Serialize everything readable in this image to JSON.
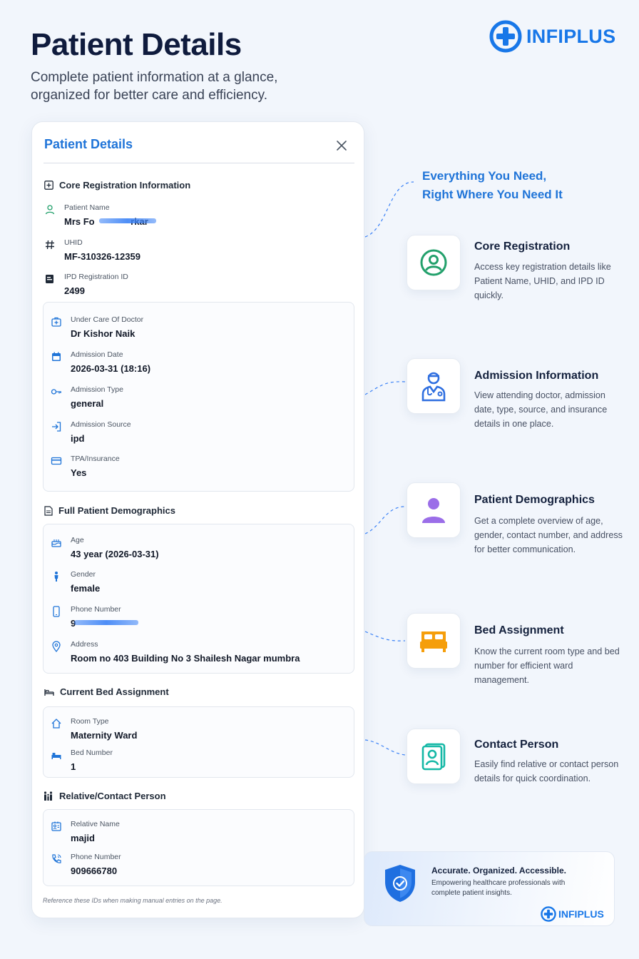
{
  "hero": {
    "title": "Patient Details",
    "subtitle": "Complete patient information at a glance, organized for better care and efficiency."
  },
  "brand": {
    "name": "INFIPLUS",
    "color": "#1877e8"
  },
  "card": {
    "title": "Patient Details",
    "close_icon": "close-icon",
    "core": {
      "heading": "Core Registration Information",
      "patient_name": {
        "label": "Patient Name",
        "value": "Mrs Fo              rkar"
      },
      "uhid": {
        "label": "UHID",
        "value": "MF-310326-12359"
      },
      "ipd": {
        "label": "IPD Registration ID",
        "value": "2499"
      },
      "doctor": {
        "label": "Under Care Of Doctor",
        "value": "Dr Kishor Naik"
      },
      "admission_date": {
        "label": "Admission Date",
        "value": "2026-03-31 (18:16)"
      },
      "admission_type": {
        "label": "Admission Type",
        "value": "general"
      },
      "admission_source": {
        "label": "Admission Source",
        "value": "ipd"
      },
      "tpa": {
        "label": "TPA/Insurance",
        "value": "Yes"
      }
    },
    "demographics": {
      "heading": "Full Patient Demographics",
      "age": {
        "label": "Age",
        "value": "43 year (2026-03-31)"
      },
      "gender": {
        "label": "Gender",
        "value": "female"
      },
      "phone": {
        "label": "Phone Number",
        "value": "9"
      },
      "address": {
        "label": "Address",
        "value": "Room no 403 Building No 3 Shailesh Nagar mumbra"
      }
    },
    "bed": {
      "heading": "Current Bed Assignment",
      "room_type": {
        "label": "Room Type",
        "value": "Maternity Ward"
      },
      "bed_number": {
        "label": "Bed Number",
        "value": "1"
      }
    },
    "contact": {
      "heading": "Relative/Contact Person",
      "relative_name": {
        "label": "Relative Name",
        "value": "majid"
      },
      "phone": {
        "label": "Phone Number",
        "value": "909666780"
      }
    },
    "footnote": "Reference these IDs when making manual entries on the page."
  },
  "tagline": {
    "line1": "Everything You Need,",
    "line2": "Right Where You Need It"
  },
  "features": [
    {
      "title": "Core Registration",
      "desc": "Access key registration details like Patient Name, UHID, and IPD ID quickly.",
      "icon": "user-circle-icon",
      "color": "#22a06b"
    },
    {
      "title": "Admission Information",
      "desc": "View attending doctor, admission date, type, source, and insurance details in one place.",
      "icon": "doctor-icon",
      "color": "#2f6fe0"
    },
    {
      "title": "Patient Demographics",
      "desc": "Get a complete overview of age, gender, contact number, and address for better communication.",
      "icon": "person-icon",
      "color": "#9b6ee8"
    },
    {
      "title": "Bed Assignment",
      "desc": "Know the current room type and bed number for efficient ward management.",
      "icon": "bed-icon",
      "color": "#f59e0b"
    },
    {
      "title": "Contact Person",
      "desc": "Easily find relative or contact person details for quick coordination.",
      "icon": "contact-card-icon",
      "color": "#14b8a6"
    }
  ],
  "promo": {
    "title": "Accurate. Organized. Accessible.",
    "desc": "Empowering healthcare professionals with complete patient insights.",
    "brand": "INFIPLUS"
  }
}
